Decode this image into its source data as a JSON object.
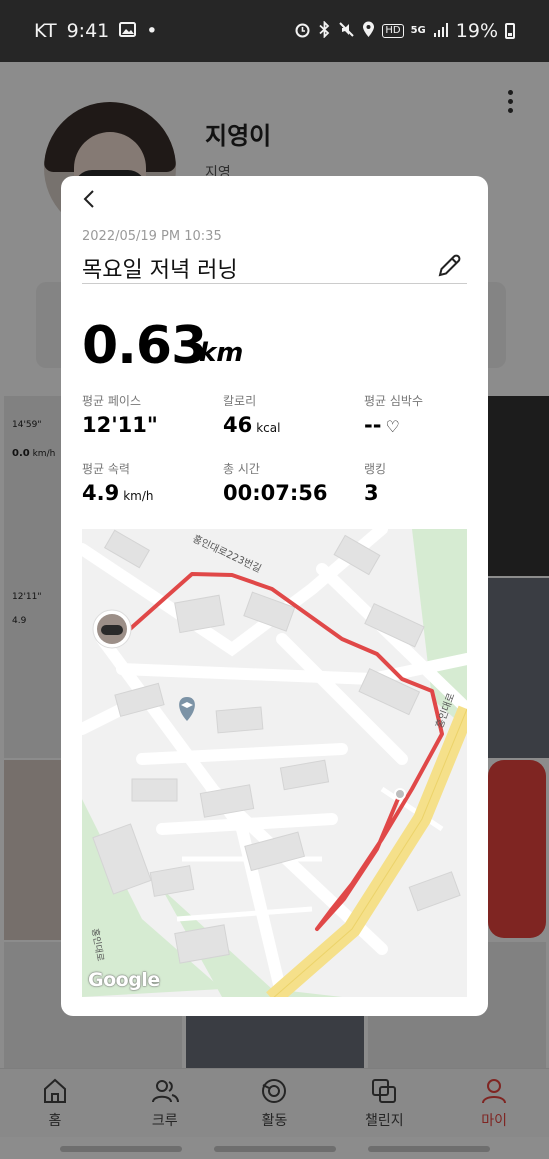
{
  "status_bar": {
    "carrier": "KT",
    "time": "9:41",
    "dot": "•",
    "network": "5G",
    "hd": "HD",
    "battery": "19%"
  },
  "profile": {
    "name": "지영이",
    "subtitle": "지영"
  },
  "background_tiles": {
    "pace_value": "14'59\"",
    "distance_value": "0.0",
    "distance_unit": "km/h",
    "pace_value_2": "12'11\"",
    "speed_value_2": "4.9"
  },
  "run_detail": {
    "date": "2022/05/19 PM 10:35",
    "title": "목요일 저녁 러닝",
    "distance": "0.63",
    "distance_unit": "km",
    "stats": [
      {
        "label": "평균 페이스",
        "value": "12'11\"",
        "unit": ""
      },
      {
        "label": "칼로리",
        "value": "46",
        "unit": "kcal"
      },
      {
        "label": "평균 심박수",
        "value": "--",
        "unit": "♡"
      },
      {
        "label": "평균 속력",
        "value": "4.9",
        "unit": "km/h"
      },
      {
        "label": "총 시간",
        "value": "00:07:56",
        "unit": ""
      },
      {
        "label": "랭킹",
        "value": "3",
        "unit": ""
      }
    ]
  },
  "map": {
    "road_label_1": "홍인대로223번길",
    "road_label_2": "홍인대로",
    "road_label_3": "홍인대로",
    "attribution": "Google",
    "route_color": "#e04848",
    "arterial_color": "#f5e08a",
    "park_color": "#cfe8cf"
  },
  "bottom_nav": {
    "items": [
      {
        "label": "홈",
        "icon": "home-icon"
      },
      {
        "label": "크루",
        "icon": "crew-icon"
      },
      {
        "label": "활동",
        "icon": "activity-icon"
      },
      {
        "label": "챌린지",
        "icon": "challenge-icon"
      },
      {
        "label": "마이",
        "icon": "profile-icon"
      }
    ],
    "active_index": 4,
    "active_color": "#e8443f"
  }
}
